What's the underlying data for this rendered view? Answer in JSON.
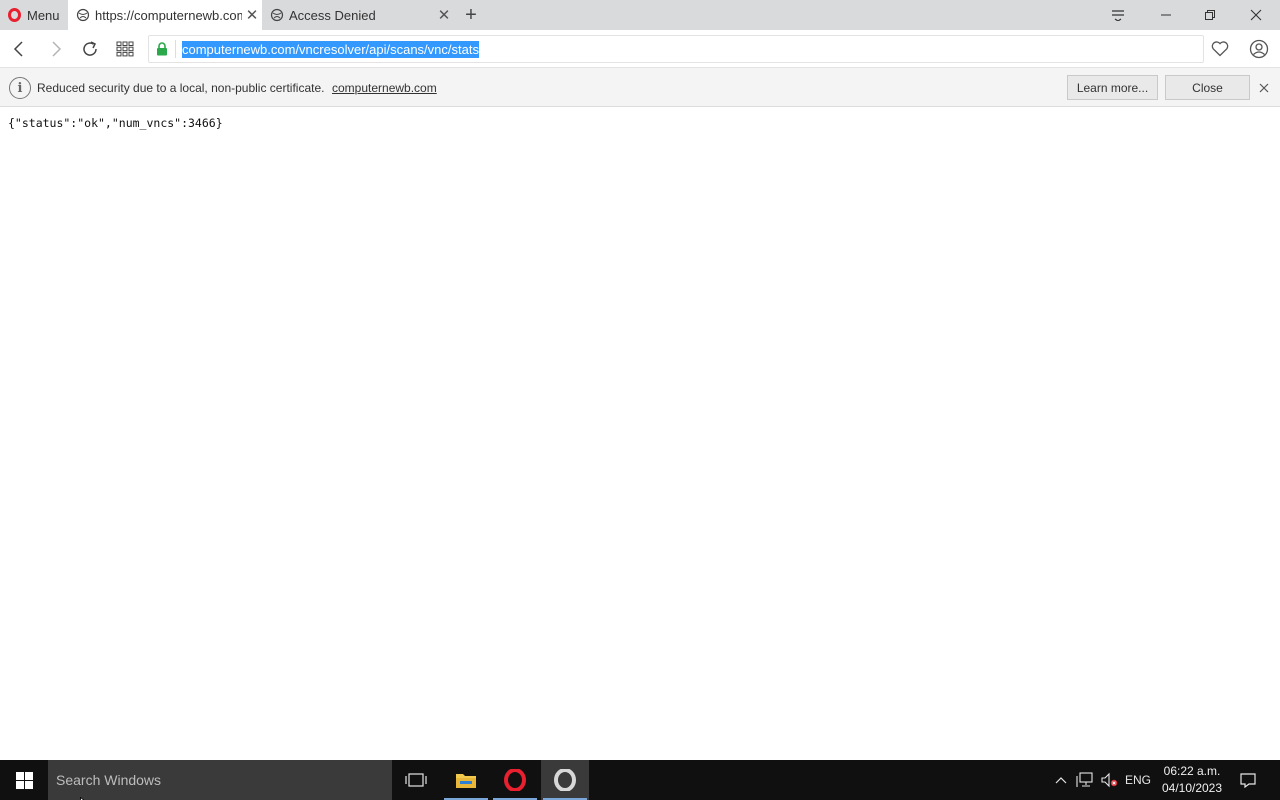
{
  "browser": {
    "menu_label": "Menu",
    "tabs": [
      {
        "title": "https://computernewb.com",
        "active": true
      },
      {
        "title": "Access Denied",
        "active": false
      }
    ],
    "address": {
      "url": "computernewb.com/vncresolver/api/scans/vnc/stats",
      "selected": true
    }
  },
  "security_notice": {
    "message": "Reduced security due to a local, non-public certificate.",
    "domain_link": "computernewb.com",
    "learn_more_label": "Learn more...",
    "close_label": "Close"
  },
  "page": {
    "raw_text": "{\"status\":\"ok\",\"num_vncs\":3466}"
  },
  "taskbar": {
    "search_placeholder": "Search Windows",
    "language": "ENG",
    "time": "06:22 a.m.",
    "date": "04/10/2023"
  },
  "colors": {
    "tab_strip": "#d9dadc",
    "url_highlight": "#3399ff",
    "opera_red": "#e8202f",
    "taskbar": "#101010"
  }
}
